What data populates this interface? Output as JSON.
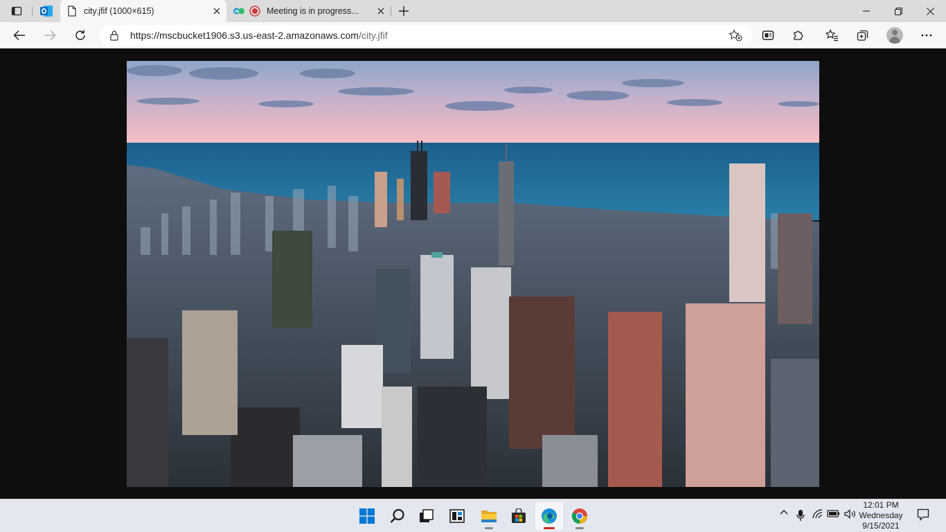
{
  "browser": {
    "tabs": [
      {
        "title": "city.jfif (1000×615)",
        "active": true
      },
      {
        "title": "Meeting is in progress...",
        "active": false
      }
    ],
    "address_bar": {
      "url_host": "https://mscbucket1906.s3.us-east-2.amazonaws.com",
      "url_path": "/city.jfif"
    }
  },
  "taskbar": {
    "apps": [
      "start-button",
      "search",
      "task-view",
      "widgets",
      "file-explorer",
      "microsoft-store",
      "edge",
      "chrome"
    ],
    "active_app": "edge",
    "clock": {
      "time": "12:01 PM",
      "day": "Wednesday",
      "date": "9/15/2021"
    }
  },
  "colors": {
    "edge_accent": "#1a8fd8",
    "recording_red": "#d13438",
    "outlook_blue": "#0f6cbd"
  }
}
